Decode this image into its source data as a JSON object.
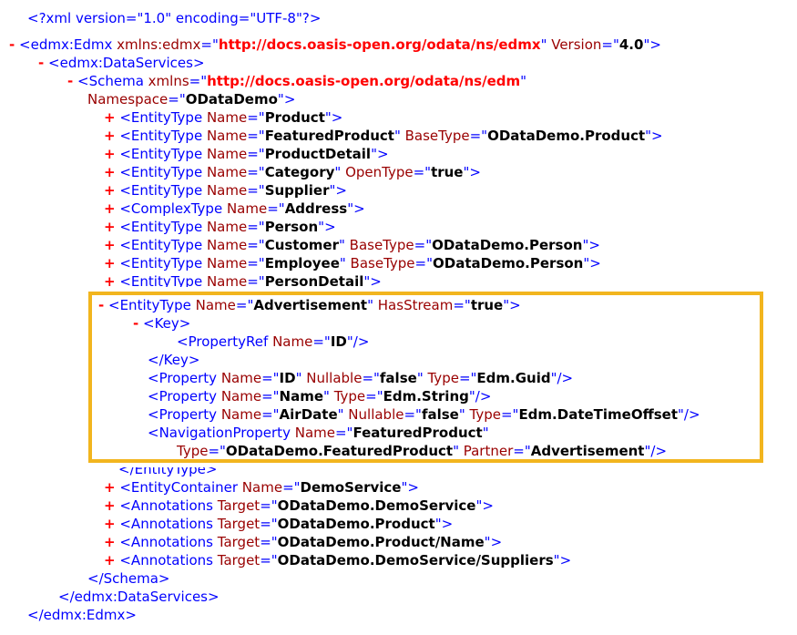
{
  "colors": {
    "tag": "#0000ff",
    "attr_name": "#990000",
    "attr_value": "#000000",
    "namespace_url": "#ff0000",
    "toggle": "#ff0000",
    "highlight_border": "#f2b51e"
  },
  "lines": [
    {
      "indent": 30,
      "toggle": "",
      "tokens": [
        [
          "pi",
          "<?xml version=\"1.0\" encoding=\"UTF-8\"?>"
        ]
      ]
    },
    {
      "indent": 10,
      "toggle": "-",
      "tokens": [
        [
          "tk",
          "<edmx:Edmx "
        ],
        [
          "an",
          "xmlns:edmx"
        ],
        [
          "tk",
          "=\""
        ],
        [
          "ur",
          "http://docs.oasis-open.org/odata/ns/edmx"
        ],
        [
          "tk",
          "\" "
        ],
        [
          "an",
          "Version"
        ],
        [
          "tk",
          "=\""
        ],
        [
          "av",
          "4.0"
        ],
        [
          "tk",
          "\">"
        ]
      ]
    },
    {
      "indent": 42,
      "toggle": "-",
      "tokens": [
        [
          "tk",
          "<edmx:DataServices>"
        ]
      ]
    },
    {
      "indent": 74,
      "toggle": "-",
      "tokens": [
        [
          "tk",
          "<Schema "
        ],
        [
          "an",
          "xmlns"
        ],
        [
          "tk",
          "=\""
        ],
        [
          "ur",
          "http://docs.oasis-open.org/odata/ns/edm"
        ],
        [
          "tk",
          "\""
        ]
      ]
    },
    {
      "indent": 96,
      "toggle": "",
      "tokens": [
        [
          "an",
          "Namespace"
        ],
        [
          "tk",
          "=\""
        ],
        [
          "av",
          "ODataDemo"
        ],
        [
          "tk",
          "\">"
        ]
      ]
    },
    {
      "indent": 114,
      "toggle": "+",
      "tokens": [
        [
          "tk",
          "<EntityType "
        ],
        [
          "an",
          "Name"
        ],
        [
          "tk",
          "=\""
        ],
        [
          "av",
          "Product"
        ],
        [
          "tk",
          "\">"
        ]
      ]
    },
    {
      "indent": 114,
      "toggle": "+",
      "tokens": [
        [
          "tk",
          "<EntityType "
        ],
        [
          "an",
          "Name"
        ],
        [
          "tk",
          "=\""
        ],
        [
          "av",
          "FeaturedProduct"
        ],
        [
          "tk",
          "\" "
        ],
        [
          "an",
          "BaseType"
        ],
        [
          "tk",
          "=\""
        ],
        [
          "av",
          "ODataDemo.Product"
        ],
        [
          "tk",
          "\">"
        ]
      ]
    },
    {
      "indent": 114,
      "toggle": "+",
      "tokens": [
        [
          "tk",
          "<EntityType "
        ],
        [
          "an",
          "Name"
        ],
        [
          "tk",
          "=\""
        ],
        [
          "av",
          "ProductDetail"
        ],
        [
          "tk",
          "\">"
        ]
      ]
    },
    {
      "indent": 114,
      "toggle": "+",
      "tokens": [
        [
          "tk",
          "<EntityType "
        ],
        [
          "an",
          "Name"
        ],
        [
          "tk",
          "=\""
        ],
        [
          "av",
          "Category"
        ],
        [
          "tk",
          "\" "
        ],
        [
          "an",
          "OpenType"
        ],
        [
          "tk",
          "=\""
        ],
        [
          "av",
          "true"
        ],
        [
          "tk",
          "\">"
        ]
      ]
    },
    {
      "indent": 114,
      "toggle": "+",
      "tokens": [
        [
          "tk",
          "<EntityType "
        ],
        [
          "an",
          "Name"
        ],
        [
          "tk",
          "=\""
        ],
        [
          "av",
          "Supplier"
        ],
        [
          "tk",
          "\">"
        ]
      ]
    },
    {
      "indent": 114,
      "toggle": "+",
      "tokens": [
        [
          "tk",
          "<ComplexType "
        ],
        [
          "an",
          "Name"
        ],
        [
          "tk",
          "=\""
        ],
        [
          "av",
          "Address"
        ],
        [
          "tk",
          "\">"
        ]
      ]
    },
    {
      "indent": 114,
      "toggle": "+",
      "tokens": [
        [
          "tk",
          "<EntityType "
        ],
        [
          "an",
          "Name"
        ],
        [
          "tk",
          "=\""
        ],
        [
          "av",
          "Person"
        ],
        [
          "tk",
          "\">"
        ]
      ]
    },
    {
      "indent": 114,
      "toggle": "+",
      "tokens": [
        [
          "tk",
          "<EntityType "
        ],
        [
          "an",
          "Name"
        ],
        [
          "tk",
          "=\""
        ],
        [
          "av",
          "Customer"
        ],
        [
          "tk",
          "\" "
        ],
        [
          "an",
          "BaseType"
        ],
        [
          "tk",
          "=\""
        ],
        [
          "av",
          "ODataDemo.Person"
        ],
        [
          "tk",
          "\">"
        ]
      ]
    },
    {
      "indent": 114,
      "toggle": "+",
      "tokens": [
        [
          "tk",
          "<EntityType "
        ],
        [
          "an",
          "Name"
        ],
        [
          "tk",
          "=\""
        ],
        [
          "av",
          "Employee"
        ],
        [
          "tk",
          "\" "
        ],
        [
          "an",
          "BaseType"
        ],
        [
          "tk",
          "=\""
        ],
        [
          "av",
          "ODataDemo.Person"
        ],
        [
          "tk",
          "\">"
        ]
      ]
    },
    {
      "indent": 114,
      "toggle": "+",
      "tokens": [
        [
          "tk",
          "<EntityType "
        ],
        [
          "an",
          "Name"
        ],
        [
          "tk",
          "=\""
        ],
        [
          "av",
          "PersonDetail"
        ],
        [
          "tk",
          "\">"
        ]
      ]
    },
    {
      "indent": 108,
      "toggle": "-",
      "tokens": [
        [
          "tk",
          "<EntityType "
        ],
        [
          "an",
          "Name"
        ],
        [
          "tk",
          "=\""
        ],
        [
          "av",
          "Advertisement"
        ],
        [
          "tk",
          "\" "
        ],
        [
          "an",
          "HasStream"
        ],
        [
          "tk",
          "=\""
        ],
        [
          "av",
          "true"
        ],
        [
          "tk",
          "\">"
        ]
      ]
    },
    {
      "indent": 146,
      "toggle": "-",
      "tokens": [
        [
          "tk",
          "<Key>"
        ]
      ]
    },
    {
      "indent": 194,
      "toggle": "",
      "tokens": [
        [
          "tk",
          "<PropertyRef "
        ],
        [
          "an",
          "Name"
        ],
        [
          "tk",
          "=\""
        ],
        [
          "av",
          "ID"
        ],
        [
          "tk",
          "\"/>"
        ]
      ]
    },
    {
      "indent": 162,
      "toggle": "",
      "tokens": [
        [
          "tk",
          "</Key>"
        ]
      ]
    },
    {
      "indent": 162,
      "toggle": "",
      "tokens": [
        [
          "tk",
          "<Property "
        ],
        [
          "an",
          "Name"
        ],
        [
          "tk",
          "=\""
        ],
        [
          "av",
          "ID"
        ],
        [
          "tk",
          "\" "
        ],
        [
          "an",
          "Nullable"
        ],
        [
          "tk",
          "=\""
        ],
        [
          "av",
          "false"
        ],
        [
          "tk",
          "\" "
        ],
        [
          "an",
          "Type"
        ],
        [
          "tk",
          "=\""
        ],
        [
          "av",
          "Edm.Guid"
        ],
        [
          "tk",
          "\"/>"
        ]
      ]
    },
    {
      "indent": 162,
      "toggle": "",
      "tokens": [
        [
          "tk",
          "<Property "
        ],
        [
          "an",
          "Name"
        ],
        [
          "tk",
          "=\""
        ],
        [
          "av",
          "Name"
        ],
        [
          "tk",
          "\" "
        ],
        [
          "an",
          "Type"
        ],
        [
          "tk",
          "=\""
        ],
        [
          "av",
          "Edm.String"
        ],
        [
          "tk",
          "\"/>"
        ]
      ]
    },
    {
      "indent": 162,
      "toggle": "",
      "tokens": [
        [
          "tk",
          "<Property "
        ],
        [
          "an",
          "Name"
        ],
        [
          "tk",
          "=\""
        ],
        [
          "av",
          "AirDate"
        ],
        [
          "tk",
          "\" "
        ],
        [
          "an",
          "Nullable"
        ],
        [
          "tk",
          "=\""
        ],
        [
          "av",
          "false"
        ],
        [
          "tk",
          "\" "
        ],
        [
          "an",
          "Type"
        ],
        [
          "tk",
          "=\""
        ],
        [
          "av",
          "Edm.DateTimeOffset"
        ],
        [
          "tk",
          "\"/>"
        ]
      ]
    },
    {
      "indent": 162,
      "toggle": "",
      "tokens": [
        [
          "tk",
          "<NavigationProperty "
        ],
        [
          "an",
          "Name"
        ],
        [
          "tk",
          "=\""
        ],
        [
          "av",
          "FeaturedProduct"
        ],
        [
          "tk",
          "\""
        ]
      ]
    },
    {
      "indent": 194,
      "toggle": "",
      "tokens": [
        [
          "an",
          "Type"
        ],
        [
          "tk",
          "=\""
        ],
        [
          "av",
          "ODataDemo.FeaturedProduct"
        ],
        [
          "tk",
          "\" "
        ],
        [
          "an",
          "Partner"
        ],
        [
          "tk",
          "=\""
        ],
        [
          "av",
          "Advertisement"
        ],
        [
          "tk",
          "\"/>"
        ]
      ]
    },
    {
      "indent": 130,
      "toggle": "",
      "tokens": [
        [
          "tk",
          "</EntityType>"
        ]
      ]
    },
    {
      "indent": 114,
      "toggle": "+",
      "tokens": [
        [
          "tk",
          "<EntityContainer "
        ],
        [
          "an",
          "Name"
        ],
        [
          "tk",
          "=\""
        ],
        [
          "av",
          "DemoService"
        ],
        [
          "tk",
          "\">"
        ]
      ]
    },
    {
      "indent": 114,
      "toggle": "+",
      "tokens": [
        [
          "tk",
          "<Annotations "
        ],
        [
          "an",
          "Target"
        ],
        [
          "tk",
          "=\""
        ],
        [
          "av",
          "ODataDemo.DemoService"
        ],
        [
          "tk",
          "\">"
        ]
      ]
    },
    {
      "indent": 114,
      "toggle": "+",
      "tokens": [
        [
          "tk",
          "<Annotations "
        ],
        [
          "an",
          "Target"
        ],
        [
          "tk",
          "=\""
        ],
        [
          "av",
          "ODataDemo.Product"
        ],
        [
          "tk",
          "\">"
        ]
      ]
    },
    {
      "indent": 114,
      "toggle": "+",
      "tokens": [
        [
          "tk",
          "<Annotations "
        ],
        [
          "an",
          "Target"
        ],
        [
          "tk",
          "=\""
        ],
        [
          "av",
          "ODataDemo.Product/Name"
        ],
        [
          "tk",
          "\">"
        ]
      ]
    },
    {
      "indent": 114,
      "toggle": "+",
      "tokens": [
        [
          "tk",
          "<Annotations "
        ],
        [
          "an",
          "Target"
        ],
        [
          "tk",
          "=\""
        ],
        [
          "av",
          "ODataDemo.DemoService/Suppliers"
        ],
        [
          "tk",
          "\">"
        ]
      ]
    },
    {
      "indent": 96,
      "toggle": "",
      "tokens": [
        [
          "tk",
          "</Schema>"
        ]
      ]
    },
    {
      "indent": 64,
      "toggle": "",
      "tokens": [
        [
          "tk",
          "</edmx:DataServices>"
        ]
      ]
    },
    {
      "indent": 30,
      "toggle": "",
      "tokens": [
        [
          "tk",
          "</edmx:Edmx>"
        ]
      ]
    }
  ]
}
